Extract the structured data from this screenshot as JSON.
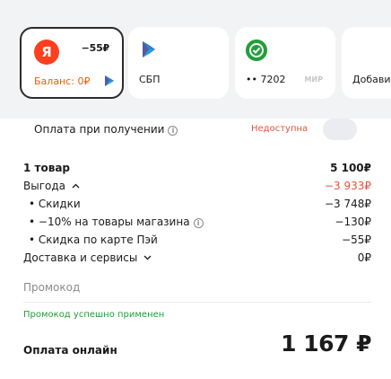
{
  "payment_methods": {
    "balance_card": {
      "cashback": "−55₽",
      "label": "Баланс: 0₽",
      "logo_letter": "Я"
    },
    "sbp_card": {
      "label": "СБП"
    },
    "bank_card": {
      "label": "•• 7202",
      "network": "МИР"
    },
    "add_card": {
      "label": "Добави"
    }
  },
  "cash_on_delivery": {
    "label": "Оплата при получении",
    "status": "Недоступна"
  },
  "summary": {
    "items": {
      "label": "1 товар",
      "value": "5 100₽"
    },
    "benefit": {
      "label": "Выгода",
      "value": "−3 933₽"
    },
    "discounts": {
      "label": "• Скидки",
      "value": "−3 748₽"
    },
    "store_discount": {
      "label": "• −10% на товары магазина",
      "value": "−130₽"
    },
    "card_discount": {
      "label": "• Скидка по карте Пэй",
      "value": "−55₽"
    },
    "delivery": {
      "label": "Доставка и сервисы",
      "value": "0₽"
    }
  },
  "promo": {
    "placeholder": "Промокод",
    "success": "Промокод успешно применен"
  },
  "total": {
    "label": "Оплата онлайн",
    "value": "1 167 ₽"
  },
  "colors": {
    "accent_orange": "#f25c05",
    "yandex_red": "#fc3f1d",
    "discount_red": "#e3533b",
    "success_green": "#21a038"
  }
}
